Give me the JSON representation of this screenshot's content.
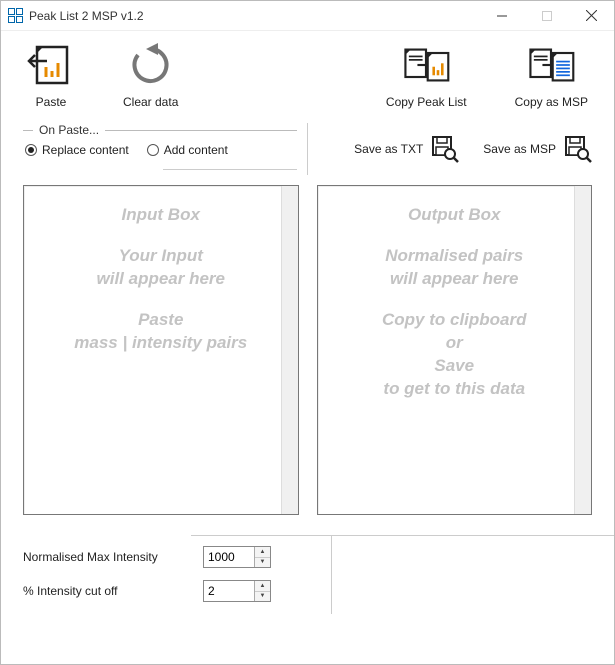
{
  "titlebar": {
    "title": "Peak List 2 MSP v1.2"
  },
  "toolbar": {
    "paste": "Paste",
    "clear": "Clear data",
    "copy_peak": "Copy Peak List",
    "copy_msp": "Copy as MSP"
  },
  "onpaste": {
    "legend": "On Paste...",
    "replace": "Replace content",
    "add": "Add content"
  },
  "save": {
    "txt": "Save as TXT",
    "msp": "Save as MSP"
  },
  "input_box": {
    "h": "Input Box",
    "l1": "Your Input",
    "l2": "will appear here",
    "l3": "Paste",
    "l4": "mass | intensity pairs"
  },
  "output_box": {
    "h": "Output  Box",
    "l1": "Normalised pairs",
    "l2": "will appear here",
    "l3": "Copy to clipboard",
    "l4": "or",
    "l5": "Save",
    "l6": "to get to this data"
  },
  "params": {
    "norm_label": "Normalised Max Intensity",
    "norm_value": "1000",
    "cut_label": "% Intensity cut off",
    "cut_value": "2"
  }
}
